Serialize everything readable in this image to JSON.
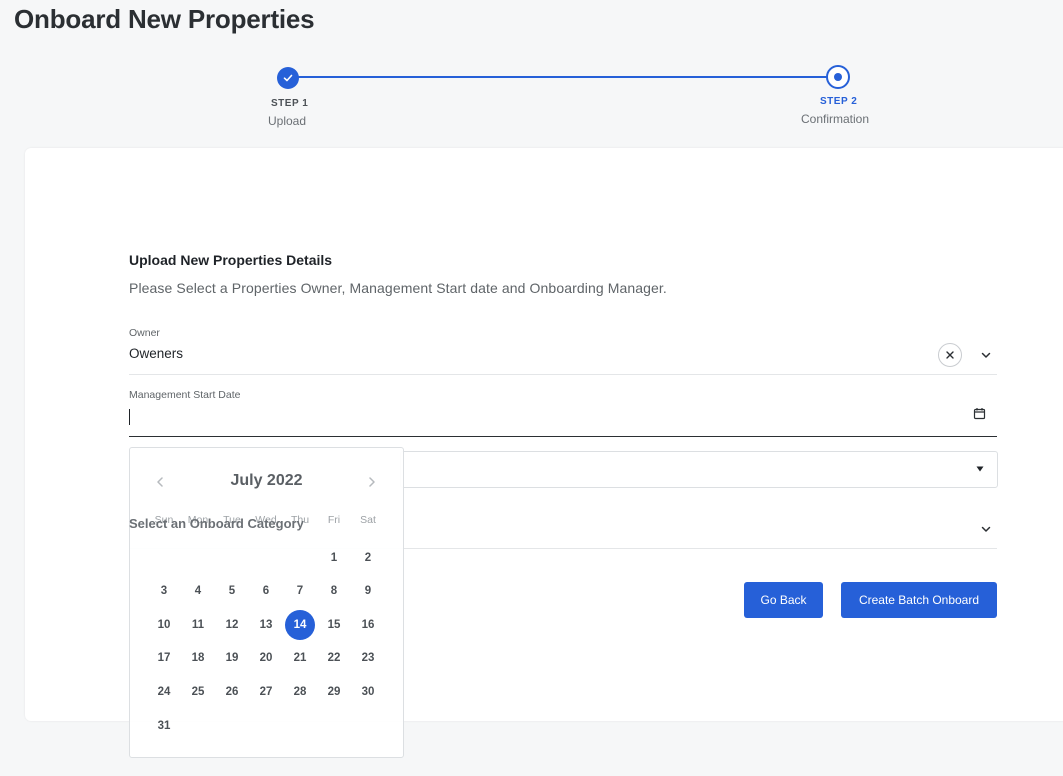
{
  "page": {
    "title": "Onboard New Properties"
  },
  "stepper": {
    "steps": [
      {
        "num": "STEP 1",
        "name": "Upload"
      },
      {
        "num": "STEP 2",
        "name": "Confirmation"
      }
    ],
    "accent": "#2660d8"
  },
  "form": {
    "title": "Upload New Properties Details",
    "subtitle": "Please Select a Properties Owner, Management Start date and Onboarding Manager.",
    "owner": {
      "label": "Owner",
      "value": "Oweners"
    },
    "start_date": {
      "label": "Management Start Date",
      "value": ""
    },
    "category": {
      "label": "Select an Onboard Category"
    }
  },
  "buttons": {
    "back": "Go Back",
    "create": "Create Batch Onboard"
  },
  "calendar": {
    "month_label": "July 2022",
    "weekdays": [
      "Sun",
      "Mon",
      "Tue",
      "Wed",
      "Thu",
      "Fri",
      "Sat"
    ],
    "first_weekday": 5,
    "days_in_month": 31,
    "selected_day": 14
  },
  "icons": {
    "step1": "check-icon",
    "clear": "close-icon",
    "owner_dropdown": "chevron-down-icon",
    "date": "calendar-icon",
    "select": "caret-down-icon",
    "category_dropdown": "chevron-down-icon",
    "prev": "chevron-left-icon",
    "next": "chevron-right-icon"
  }
}
